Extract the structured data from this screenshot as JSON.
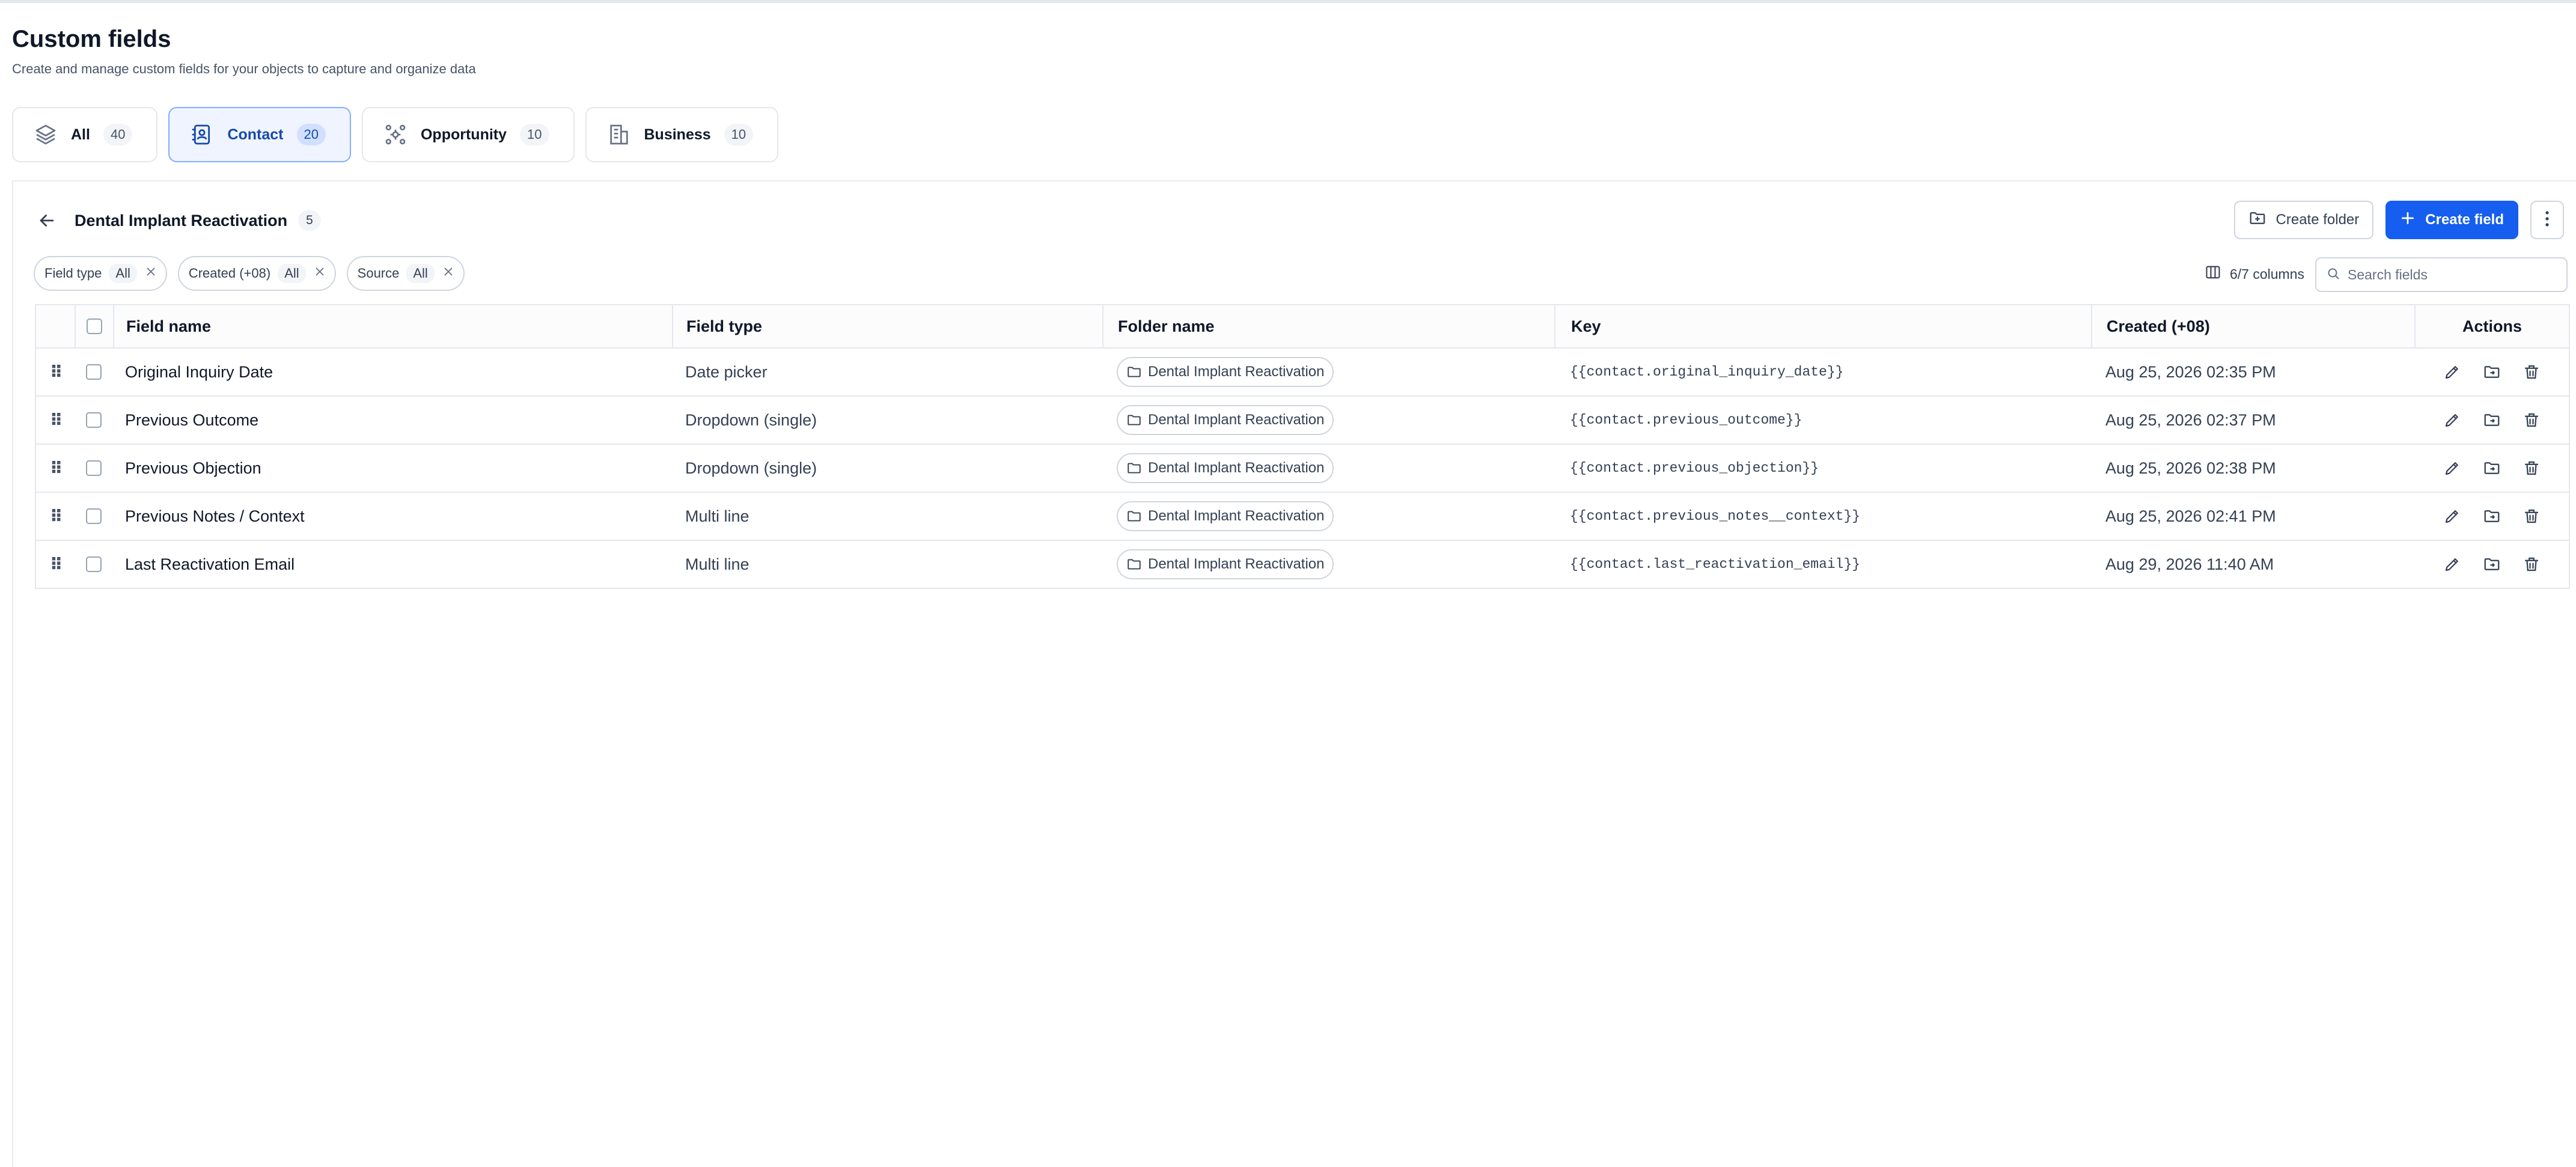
{
  "header": {
    "title": "Custom fields",
    "subtitle": "Create and manage custom fields for your objects to capture and organize data"
  },
  "tabs": [
    {
      "label": "All",
      "count": "40",
      "icon": "layers-icon",
      "active": false
    },
    {
      "label": "Contact",
      "count": "20",
      "icon": "contact-card-icon",
      "active": true
    },
    {
      "label": "Opportunity",
      "count": "10",
      "icon": "opportunity-icon",
      "active": false
    },
    {
      "label": "Business",
      "count": "10",
      "icon": "building-icon",
      "active": false
    }
  ],
  "folder": {
    "name": "Dental Implant Reactivation",
    "count": "5"
  },
  "actions": {
    "create_folder": "Create folder",
    "create_field": "Create field"
  },
  "filters": [
    {
      "label": "Field type",
      "value": "All"
    },
    {
      "label": "Created (+08)",
      "value": "All"
    },
    {
      "label": "Source",
      "value": "All"
    }
  ],
  "columns_label": "6/7 columns",
  "search": {
    "placeholder": "Search fields"
  },
  "table": {
    "headers": {
      "name": "Field name",
      "type": "Field type",
      "folder": "Folder name",
      "key": "Key",
      "created": "Created (+08)",
      "actions": "Actions"
    },
    "rows": [
      {
        "name": "Original Inquiry Date",
        "type": "Date picker",
        "folder": "Dental Implant Reactivation",
        "key": "{{contact.original_inquiry_date}}",
        "created": "Aug 25, 2026 02:35 PM"
      },
      {
        "name": "Previous Outcome",
        "type": "Dropdown (single)",
        "folder": "Dental Implant Reactivation",
        "key": "{{contact.previous_outcome}}",
        "created": "Aug 25, 2026 02:37 PM"
      },
      {
        "name": "Previous Objection",
        "type": "Dropdown (single)",
        "folder": "Dental Implant Reactivation",
        "key": "{{contact.previous_objection}}",
        "created": "Aug 25, 2026 02:38 PM"
      },
      {
        "name": "Previous Notes / Context",
        "type": "Multi line",
        "folder": "Dental Implant Reactivation",
        "key": "{{contact.previous_notes__context}}",
        "created": "Aug 25, 2026 02:41 PM"
      },
      {
        "name": "Last Reactivation Email",
        "type": "Multi line",
        "folder": "Dental Implant Reactivation",
        "key": "{{contact.last_reactivation_email}}",
        "created": "Aug 29, 2026 11:40 AM"
      }
    ]
  },
  "colors": {
    "primary": "#155eef",
    "active_tab_bg": "#eff4ff",
    "border": "#e4e7ec"
  }
}
